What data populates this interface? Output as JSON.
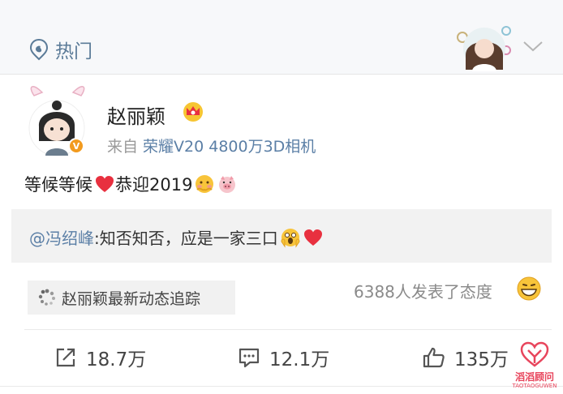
{
  "header": {
    "hot_icon": "hot-topic-icon",
    "hot_label": "热门",
    "chevron_icon": "chevron-down-icon"
  },
  "post": {
    "author": "赵丽颖",
    "badge_icon": "crown-icon",
    "verified_icon": "verified-badge-icon",
    "source_prefix": "来自",
    "source_device": "荣耀V20 4800万3D相机",
    "text_part1": "等候等候",
    "text_part2": "恭迎2019",
    "emojis": [
      "heart-icon",
      "blush-emoji-icon",
      "pig-emoji-icon"
    ]
  },
  "repost": {
    "mention": "@冯绍峰",
    "text": ":知否知否，应是一家三口",
    "emojis": [
      "surprised-emoji-icon",
      "heart-icon"
    ]
  },
  "tracker": {
    "label": "赵丽颖最新动态追踪"
  },
  "reactions": {
    "count_text": "6388人发表了态度"
  },
  "actions": {
    "share_count": "18.7万",
    "comment_count": "12.1万",
    "like_count": "135万"
  },
  "watermark": {
    "cn": "滔滔顾问",
    "en": "TAOTAOGUWEN"
  },
  "colors": {
    "link": "#5b7fa6",
    "muted": "#9a9a9a",
    "accent_red": "#e8303f",
    "watermark": "#e8455c"
  }
}
